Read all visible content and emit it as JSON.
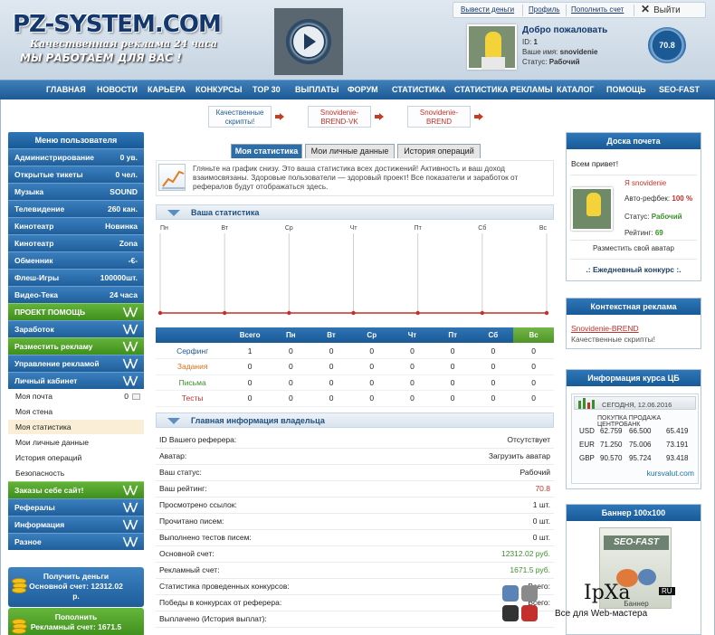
{
  "header": {
    "logo": "PZ-SYSTEM.COM",
    "slogan1": "Качественная реклама 24 часа",
    "slogan2": "МЫ РАБОТАЕМ ДЛЯ ВАС !",
    "links": [
      "Вывести деньги",
      "Профиль",
      "Пополнить счет"
    ],
    "exit": "Выйти",
    "welcome": "Добро пожаловать",
    "id_label": "ID:",
    "id_value": "1",
    "user_label": "Ваше имя:",
    "user_value": "snovidenie",
    "status_label": "Статус:",
    "status_value": "Рабочий",
    "rating": "70.8"
  },
  "nav": [
    "ГЛАВНАЯ",
    "НОВОСТИ",
    "КАРЬЕРА",
    "КОНКУРСЫ",
    "TOP 30",
    "ВЫПЛАТЫ",
    "ФОРУМ",
    "СТАТИСТИКА",
    "СТАТИСТИКА РЕКЛАМЫ",
    "КАТАЛОГ",
    "ПОМОЩЬ",
    "SEO-FAST"
  ],
  "promos": [
    {
      "l1": "Качественные",
      "l2": "скрипты!",
      "color": "#1a5a96"
    },
    {
      "l1": "Snovidenie-",
      "l2": "BREND-VK",
      "color": "#c4302b"
    },
    {
      "l1": "Snovidenie-",
      "l2": "BREND",
      "color": "#c4302b"
    }
  ],
  "left": {
    "title": "Меню пользователя",
    "items": [
      {
        "label": "Администрирование",
        "value": "0 ув."
      },
      {
        "label": "Открытые тикеты",
        "value": "0 чел."
      },
      {
        "label": "Музыка",
        "value": "SOUND"
      },
      {
        "label": "Телевидение",
        "value": "260 кан."
      },
      {
        "label": "Кинотеатр",
        "value": "Новинка"
      },
      {
        "label": "Кинотеатр",
        "value": "Zona"
      },
      {
        "label": "Обменник",
        "value": "-€-"
      },
      {
        "label": "Флеш-Игры",
        "value": "100000шт."
      },
      {
        "label": "Видео-Тека",
        "value": "24 часа"
      }
    ],
    "green1": "ПРОЕКТ ПОМОЩЬ",
    "groups1": [
      "Заработок"
    ],
    "green2": "Разместить рекламу",
    "groups2": [
      "Управление рекламой",
      "Личный кабинет"
    ],
    "sub": [
      {
        "label": "Моя почта",
        "count": "0"
      },
      {
        "label": "Моя стена"
      },
      {
        "label": "Моя статистика"
      },
      {
        "label": "Мои личные данные"
      },
      {
        "label": "История операций"
      },
      {
        "label": "Безопасность"
      }
    ],
    "green3": "Заказы себе сайт!",
    "groups3": [
      "Рефералы",
      "Информация",
      "Разное"
    ],
    "pay1": {
      "l1": "Получить деньги",
      "l2": "Основной счет: 12312.02",
      "l3": "р."
    },
    "pay2": {
      "l1": "Пополнить",
      "l2": "Рекламный счет: 1671.5",
      "l3": "р."
    }
  },
  "tabs": [
    "Моя статистика",
    "Мои личные данные",
    "История операций"
  ],
  "intro": "Гляньте на график снизу. Это ваша статистика всех достижений! Активность и ваш доход взаимосвязаны. Здоровые пользователи — здоровый проект! Все показатели и заработок от рефералов будут отображаться здесь.",
  "stats_title": "Ваша статистика",
  "chart_data": {
    "type": "line",
    "categories": [
      "Пн",
      "Вт",
      "Ср",
      "Чт",
      "Пт",
      "Сб",
      "Вс"
    ],
    "values": [
      0,
      0,
      0,
      0,
      0,
      0,
      0
    ],
    "title": "",
    "xlabel": "",
    "ylabel": "",
    "grid": true,
    "color": "#c4302b"
  },
  "table": {
    "headers": [
      "",
      "Всего",
      "Пн",
      "Вт",
      "Ср",
      "Чт",
      "Пт",
      "Сб",
      "Вс"
    ],
    "rows": [
      {
        "label": "Серфинг",
        "color": "#1a5a96",
        "cells": [
          "1",
          "0",
          "0",
          "0",
          "0",
          "0",
          "0",
          "0"
        ]
      },
      {
        "label": "Задания",
        "color": "#d6711c",
        "cells": [
          "0",
          "0",
          "0",
          "0",
          "0",
          "0",
          "0",
          "0"
        ]
      },
      {
        "label": "Письма",
        "color": "#3a8f2a",
        "cells": [
          "0",
          "0",
          "0",
          "0",
          "0",
          "0",
          "0",
          "0"
        ]
      },
      {
        "label": "Тесты",
        "color": "#c4302b",
        "cells": [
          "0",
          "0",
          "0",
          "0",
          "0",
          "0",
          "0",
          "0"
        ]
      }
    ]
  },
  "owner_title": "Главная информация владельца",
  "owner": [
    {
      "k": "ID Вашего реферера:",
      "v": "Отсутствует",
      "c": "#222"
    },
    {
      "k": "Аватар:",
      "v": "Загрузить аватар",
      "c": "#222"
    },
    {
      "k": "Ваш статус:",
      "v": "Рабочий",
      "c": "#222"
    },
    {
      "k": "Ваш рейтинг:",
      "v": "70.8",
      "c": "#c4302b"
    },
    {
      "k": "Просмотрено ссылок:",
      "v": "1 шт.",
      "c": "#222"
    },
    {
      "k": "Прочитано писем:",
      "v": "0 шт.",
      "c": "#222"
    },
    {
      "k": "Выполнено тестов писем:",
      "v": "0 шт.",
      "c": "#222"
    },
    {
      "k": "Основной счет:",
      "v": "12312.02 руб.",
      "c": "#3a8f2a"
    },
    {
      "k": "Рекламный счет:",
      "v": "1671.5 руб.",
      "c": "#3a8f2a"
    },
    {
      "k": "Статистика проведенных конкурсов:",
      "v": "Всего:",
      "c": "#222"
    },
    {
      "k": "Победы в конкурсах от реферера:",
      "v": "Всего:",
      "c": "#222"
    },
    {
      "k": "Выплачено (История выплат):",
      "v": "",
      "c": "#222"
    }
  ],
  "right": {
    "board_title": "Доска почета",
    "hello": "Всем привет!",
    "name": "Я snovidenie",
    "autoref_label": "Авто-рефбек:",
    "autoref_value": "100 %",
    "status_label": "Статус:",
    "status_value": "Рабочий",
    "rating_label": "Рейтинг:",
    "rating_value": "69",
    "avatar_link": "Разместить свой аватар",
    "contest": ".: Ежедневный конкурс :.",
    "ctx_title": "Контекстная реклама",
    "ctx_link": "Snovidenie-BREND",
    "ctx_text": "Качественные скрипты!",
    "cb_title": "Информация курса ЦБ",
    "cb_date": "СЕГОДНЯ, 12.06.2016",
    "cb_head": "ПОКУПКА  ПРОДАЖА  ЦЕНТРОБАНК",
    "cb_rows": [
      {
        "cur": "USD",
        "buy": "62.759",
        "sell": "66.500",
        "cb": "65.419"
      },
      {
        "cur": "EUR",
        "buy": "71.250",
        "sell": "75.006",
        "cb": "73.191"
      },
      {
        "cur": "GBP",
        "buy": "90.570",
        "sell": "95.724",
        "cb": "93.418"
      }
    ],
    "cb_site": "kursvalut.com",
    "banner_title": "Баннер 100х100",
    "banner_logo": "SEO-FAST",
    "banner_caption": "Баннер"
  },
  "watermark": {
    "big": "IpXa",
    "ru": "RU",
    "sub": "Все для Web-мастера"
  }
}
